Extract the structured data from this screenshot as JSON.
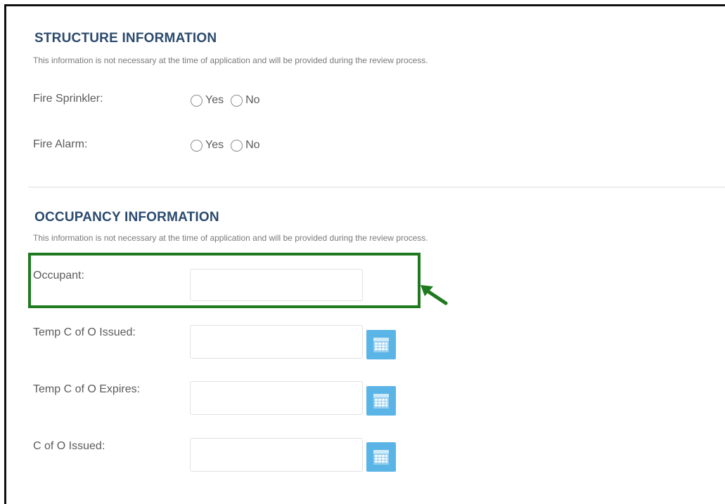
{
  "structure": {
    "title": "STRUCTURE INFORMATION",
    "note": "This information is not necessary at the time of application and will be provided during the review process.",
    "fire_sprinkler": {
      "label": "Fire Sprinkler:",
      "yes": "Yes",
      "no": "No"
    },
    "fire_alarm": {
      "label": "Fire Alarm:",
      "yes": "Yes",
      "no": "No"
    }
  },
  "occupancy": {
    "title": "OCCUPANCY INFORMATION",
    "note": "This information is not necessary at the time of application and will be provided during the review process.",
    "occupant": {
      "label": "Occupant:",
      "value": ""
    },
    "temp_co_issued": {
      "label": "Temp C of O Issued:",
      "value": ""
    },
    "temp_co_expires": {
      "label": "Temp C of O Expires:",
      "value": ""
    },
    "co_issued": {
      "label": "C of O Issued:",
      "value": ""
    }
  },
  "colors": {
    "section_title": "#2b4a6e",
    "calendar_button": "#5ab4e6",
    "highlight": "#1f7a1f"
  },
  "icons": {
    "calendar": "calendar-icon",
    "arrow": "arrow-icon"
  }
}
